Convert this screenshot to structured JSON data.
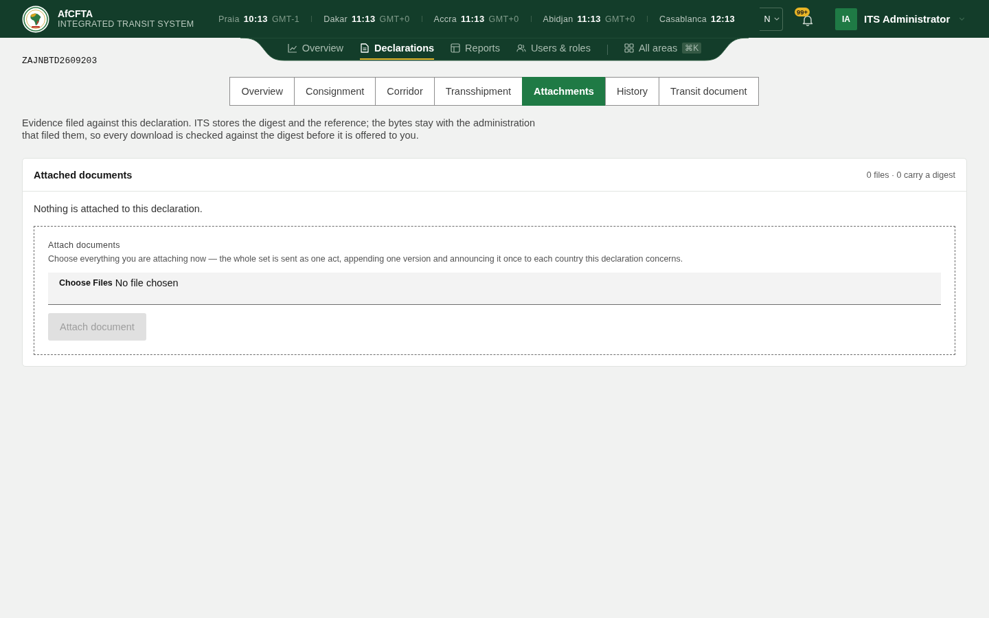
{
  "header": {
    "brand": {
      "name": "AfCFTA",
      "subtitle": "INTEGRATED TRANSIT SYSTEM"
    },
    "clocks": [
      {
        "city": "Praia",
        "time": "10:13",
        "zone": "GMT-1"
      },
      {
        "city": "Dakar",
        "time": "11:13",
        "zone": "GMT+0"
      },
      {
        "city": "Accra",
        "time": "11:13",
        "zone": "GMT+0"
      },
      {
        "city": "Abidjan",
        "time": "11:13",
        "zone": "GMT+0"
      },
      {
        "city": "Casablanca",
        "time": "12:13"
      }
    ],
    "language_select": {
      "value": "N"
    },
    "notifications": {
      "badge": "99+"
    },
    "user": {
      "initials": "IA",
      "name": "ITS Administrator"
    }
  },
  "nav": {
    "items": [
      {
        "label": "Overview",
        "selected": false
      },
      {
        "label": "Declarations",
        "selected": true
      },
      {
        "label": "Reports",
        "selected": false
      },
      {
        "label": "Users & roles",
        "selected": false
      }
    ],
    "all_areas": {
      "label": "All areas",
      "shortcut": "⌘K"
    }
  },
  "reference": "ZAJNBTD2609203",
  "tabs": [
    {
      "label": "Overview",
      "selected": false
    },
    {
      "label": "Consignment",
      "selected": false
    },
    {
      "label": "Corridor",
      "selected": false
    },
    {
      "label": "Transshipment",
      "selected": false
    },
    {
      "label": "Attachments",
      "selected": true
    },
    {
      "label": "History",
      "selected": false
    },
    {
      "label": "Transit document",
      "selected": false
    }
  ],
  "description": "Evidence filed against this declaration. ITS stores the digest and the reference; the bytes stay with the administration that filed them, so every download is checked against the digest before it is offered to you.",
  "attachments": {
    "title": "Attached documents",
    "summary": "0 files · 0 carry a digest",
    "empty_message": "Nothing is attached to this declaration.",
    "form": {
      "label": "Attach documents",
      "help": "Choose everything you are attaching now — the whole set is sent as one act, appending one version and announcing it once to each country this declaration concerns.",
      "file_input": {
        "button": "Choose Files",
        "status": "No file chosen"
      },
      "submit": {
        "label": "Attach document",
        "disabled": true
      }
    }
  }
}
